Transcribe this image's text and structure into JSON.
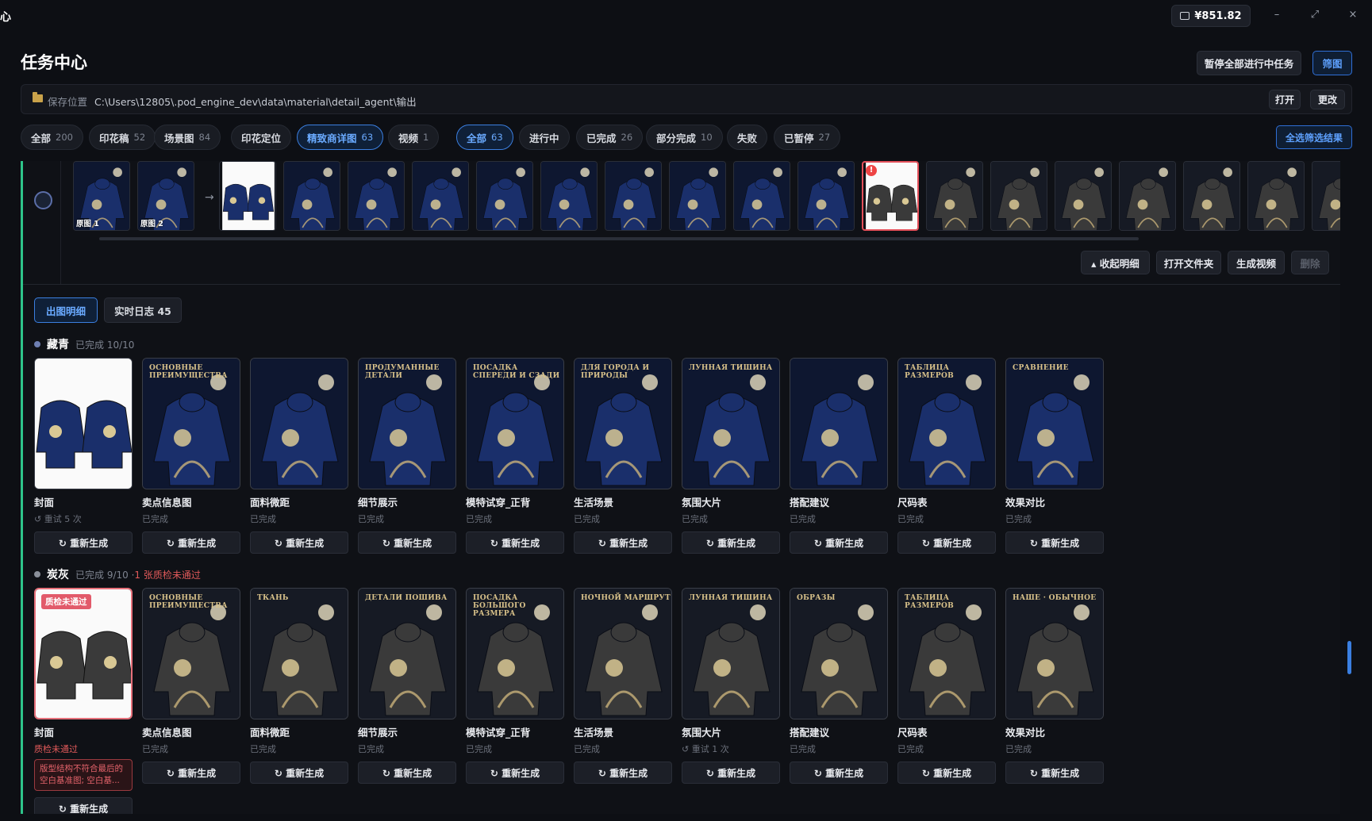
{
  "titlebar": {
    "app_glyph": "心",
    "balance": "¥851.82",
    "min": "–",
    "restore": "⤢",
    "close": "×"
  },
  "header": {
    "title": "任务中心",
    "pause_all": "暂停全部进行中任务",
    "filter": "筛图"
  },
  "save_path": {
    "label": "保存位置",
    "path": "C:\\Users\\12805\\.pod_engine_dev\\data\\material\\detail_agent\\输出",
    "open": "打开",
    "change": "更改"
  },
  "type_filters": [
    {
      "label": "全部",
      "count": "200"
    },
    {
      "label": "印花稿",
      "count": "52"
    },
    {
      "label": "场景图",
      "count": "84"
    },
    {
      "label": "印花定位",
      "count": ""
    },
    {
      "label": "精致商详图",
      "count": "63"
    },
    {
      "label": "视频",
      "count": "1"
    }
  ],
  "status_filters": [
    {
      "label": "全部",
      "count": "63"
    },
    {
      "label": "进行中",
      "count": ""
    },
    {
      "label": "已完成",
      "count": "26"
    },
    {
      "label": "部分完成",
      "count": "10"
    },
    {
      "label": "失败",
      "count": ""
    },
    {
      "label": "已暂停",
      "count": "27"
    }
  ],
  "select_all_results": "全选筛选结果",
  "strip": {
    "source1": "原图 1",
    "source2": "原图 2",
    "arrow": "→",
    "error_mark": "!"
  },
  "actions": {
    "collapse": "▴ 收起明细",
    "open_folder": "打开文件夹",
    "gen_video": "生成视频",
    "delete": "删除"
  },
  "tabs": {
    "detail": "出图明细",
    "log": "实时日志 45"
  },
  "colors": {
    "accent": "#3b7fe0",
    "success_bar": "#2ec48a",
    "error": "#e25a5a",
    "navy": "#1a2f6b",
    "charcoal": "#3a3a3a"
  },
  "groups": [
    {
      "name": "藏青",
      "status": "已完成 10/10",
      "fail_note": "",
      "cards": [
        {
          "caption": "封面",
          "sub": "↺ 重试 5 次",
          "img_title": "",
          "regen": "↻ 重新生成"
        },
        {
          "caption": "卖点信息图",
          "sub": "已完成",
          "img_title": "ОСНОВНЫЕ ПРЕИМУЩЕСТВА",
          "regen": "↻ 重新生成"
        },
        {
          "caption": "面料微距",
          "sub": "已完成",
          "img_title": "",
          "regen": "↻ 重新生成"
        },
        {
          "caption": "细节展示",
          "sub": "已完成",
          "img_title": "ПРОДУМАННЫЕ ДЕТАЛИ",
          "regen": "↻ 重新生成"
        },
        {
          "caption": "模特试穿_正背",
          "sub": "已完成",
          "img_title": "ПОСАДКА СПЕРЕДИ И СЗАДИ",
          "regen": "↻ 重新生成"
        },
        {
          "caption": "生活场景",
          "sub": "已完成",
          "img_title": "ДЛЯ ГОРОДА И ПРИРОДЫ",
          "regen": "↻ 重新生成"
        },
        {
          "caption": "氛围大片",
          "sub": "已完成",
          "img_title": "ЛУННАЯ ТИШИНА",
          "regen": "↻ 重新生成"
        },
        {
          "caption": "搭配建议",
          "sub": "已完成",
          "img_title": "",
          "regen": "↻ 重新生成"
        },
        {
          "caption": "尺码表",
          "sub": "已完成",
          "img_title": "ТАБЛИЦА РАЗМЕРОВ",
          "regen": "↻ 重新生成"
        },
        {
          "caption": "效果对比",
          "sub": "已完成",
          "img_title": "СРАВНЕНИЕ",
          "regen": "↻ 重新生成"
        }
      ]
    },
    {
      "name": "炭灰",
      "status": "已完成 9/10 · ",
      "fail_note": "1 张质检未通过",
      "cards": [
        {
          "caption": "封面",
          "sub": "质检未通过",
          "img_title": "",
          "badge": "质检未通过",
          "error": "版型结构不符合最后的空白基准图; 空白基...",
          "regen": "↻ 重新生成"
        },
        {
          "caption": "卖点信息图",
          "sub": "已完成",
          "img_title": "ОСНОВНЫЕ ПРЕИМУЩЕСТВА",
          "regen": "↻ 重新生成"
        },
        {
          "caption": "面料微距",
          "sub": "已完成",
          "img_title": "ТКАНЬ",
          "regen": "↻ 重新生成"
        },
        {
          "caption": "细节展示",
          "sub": "已完成",
          "img_title": "ДЕТАЛИ ПОШИВА",
          "regen": "↻ 重新生成"
        },
        {
          "caption": "模特试穿_正背",
          "sub": "已完成",
          "img_title": "ПОСАДКА БОЛЬШОГО РАЗМЕРА",
          "regen": "↻ 重新生成"
        },
        {
          "caption": "生活场景",
          "sub": "已完成",
          "img_title": "НОЧНОЙ МАРШРУТ",
          "regen": "↻ 重新生成"
        },
        {
          "caption": "氛围大片",
          "sub": "↺ 重试 1 次",
          "img_title": "ЛУННАЯ ТИШИНА",
          "regen": "↻ 重新生成"
        },
        {
          "caption": "搭配建议",
          "sub": "已完成",
          "img_title": "ОБРАЗЫ",
          "regen": "↻ 重新生成"
        },
        {
          "caption": "尺码表",
          "sub": "已完成",
          "img_title": "ТАБЛИЦА РАЗМЕРОВ",
          "regen": "↻ 重新生成"
        },
        {
          "caption": "效果对比",
          "sub": "已完成",
          "img_title": "НАШЕ · ОБЫЧНОЕ",
          "regen": "↻ 重新生成"
        }
      ]
    }
  ]
}
